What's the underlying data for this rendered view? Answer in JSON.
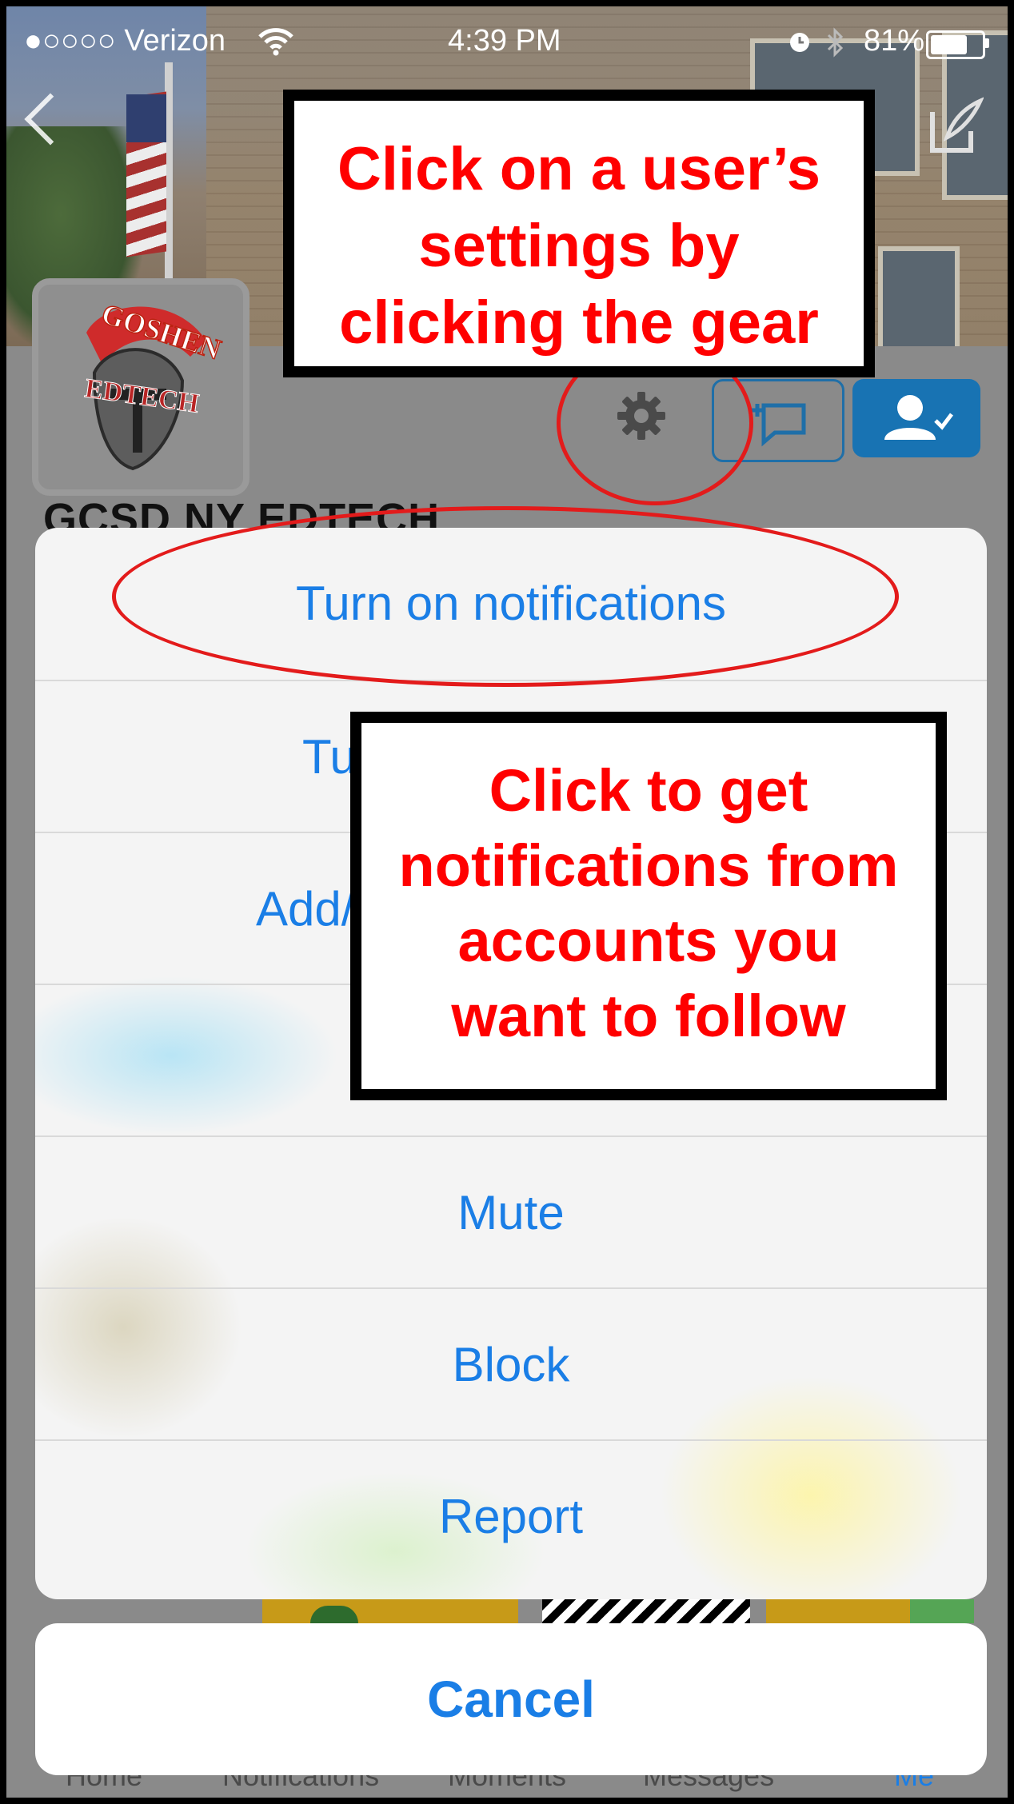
{
  "status_bar": {
    "carrier": "●○○○○ Verizon",
    "time": "4:39 PM",
    "battery": "81%",
    "battery_level": 0.81
  },
  "profile": {
    "avatar_text_1": "GOSHEN",
    "avatar_text_2": "EDTECH",
    "name_partial": "GCSD NY EDTECH"
  },
  "action_sheet": {
    "items": [
      {
        "label": "Turn on notifications"
      },
      {
        "label": "Tu"
      },
      {
        "label": "Add/"
      },
      {
        "label": ""
      },
      {
        "label": "Mute"
      },
      {
        "label": "Block"
      },
      {
        "label": "Report"
      }
    ],
    "cancel_label": "Cancel"
  },
  "tab_bar": {
    "items": [
      "Home",
      "Notifications",
      "Moments",
      "Messages",
      "Me"
    ]
  },
  "annotations": {
    "top_callout": "Click on a user’s settings by clicking the gear",
    "top_callout_lines": [
      "Click on a user’s",
      "settings by",
      "clicking the gear"
    ],
    "middle_callout_lines": [
      "Click to get",
      "notifications from",
      "accounts you",
      "want to follow"
    ]
  },
  "colors": {
    "ios_blue": "#1a7ee6",
    "annotation_red": "#ff0000",
    "follow_blue": "#1873b3"
  },
  "icons": [
    "back-chevron-icon",
    "compose-icon",
    "gear-icon",
    "direct-message-icon",
    "following-icon",
    "wifi-icon",
    "alarm-icon",
    "bluetooth-icon",
    "battery-icon"
  ]
}
